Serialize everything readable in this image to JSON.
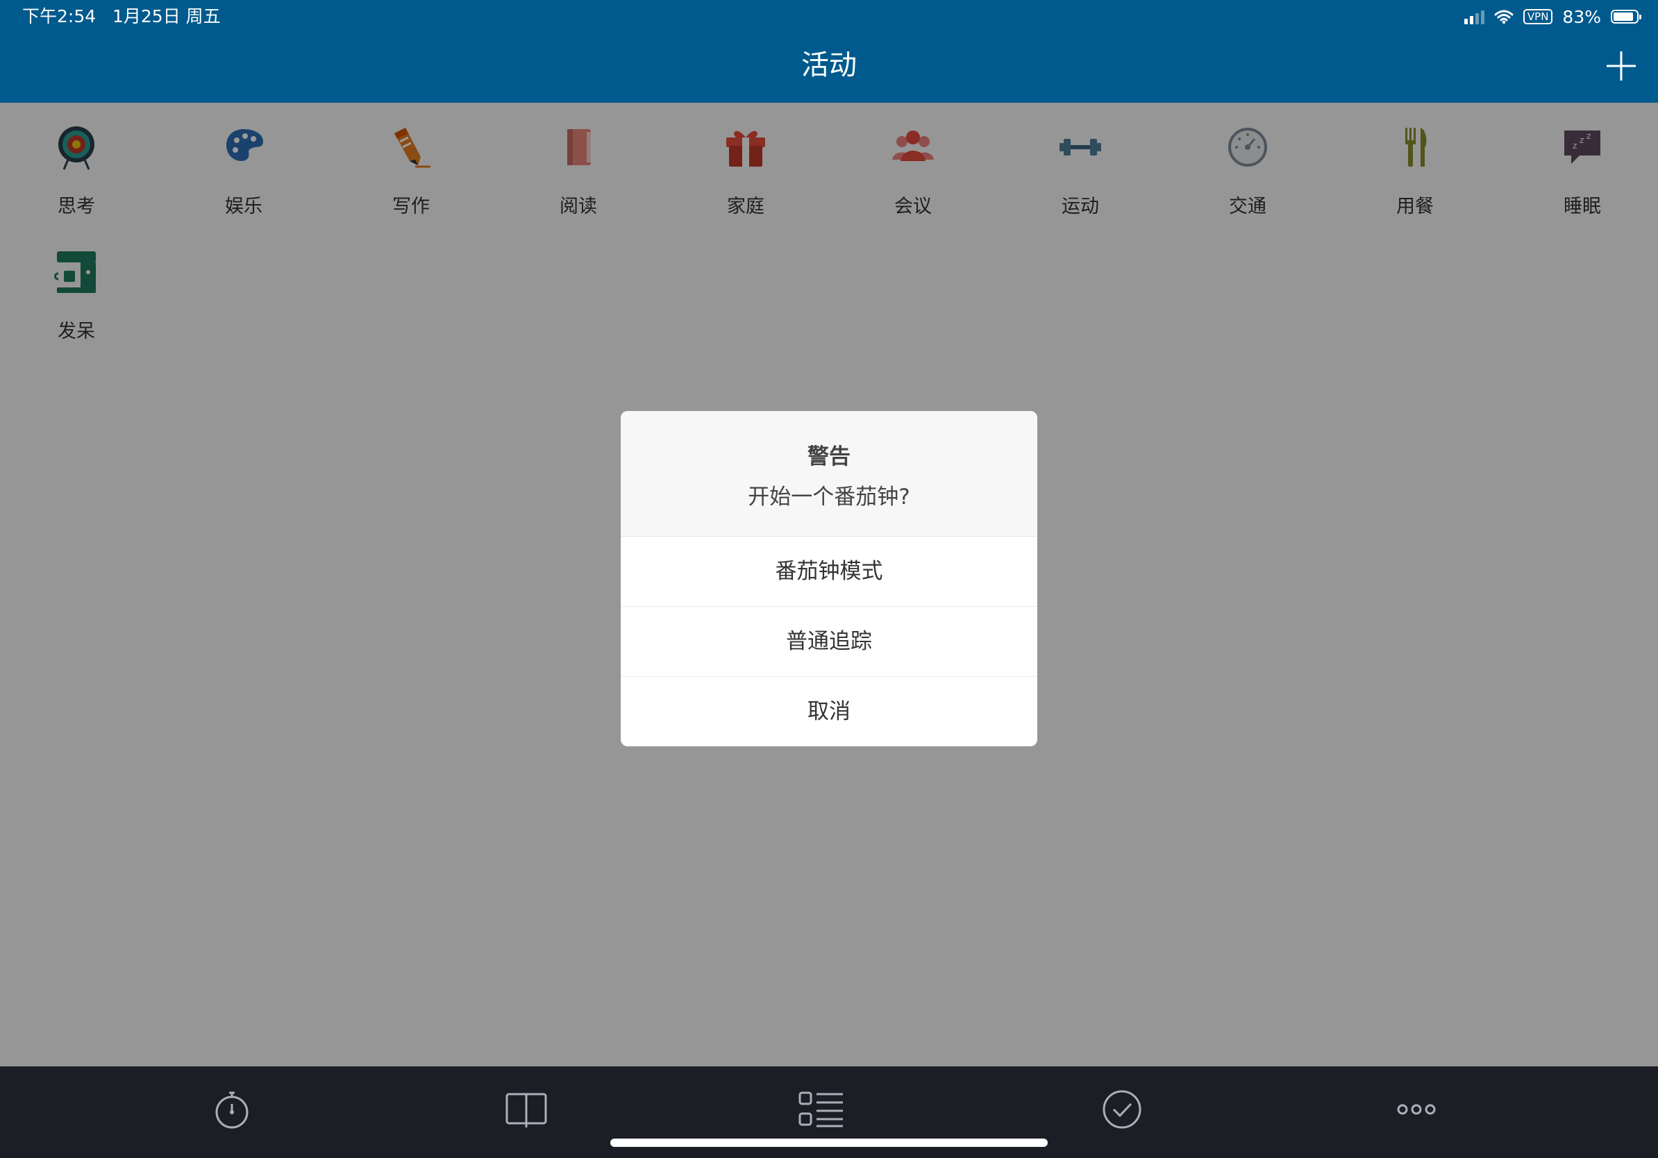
{
  "status_bar": {
    "time": "下午2:54",
    "date": "1月25日 周五",
    "battery": "83%",
    "vpn": "VPN"
  },
  "header": {
    "title": "活动",
    "add_icon": "plus-icon"
  },
  "activities": [
    {
      "label": "思考",
      "icon": "target-icon",
      "color": "#c0392b"
    },
    {
      "label": "娱乐",
      "icon": "palette-icon",
      "color": "#2d6fb4"
    },
    {
      "label": "写作",
      "icon": "pencil-icon",
      "color": "#e67e22"
    },
    {
      "label": "阅读",
      "icon": "book-icon",
      "color": "#e8857a"
    },
    {
      "label": "家庭",
      "icon": "gift-icon",
      "color": "#c0392b"
    },
    {
      "label": "会议",
      "icon": "people-icon",
      "color": "#e74c3c"
    },
    {
      "label": "运动",
      "icon": "dumbbell-icon",
      "color": "#4f7f9b"
    },
    {
      "label": "交通",
      "icon": "speedometer-icon",
      "color": "#7f8c9a"
    },
    {
      "label": "用餐",
      "icon": "fork-knife-icon",
      "color": "#8a8c2e"
    },
    {
      "label": "睡眠",
      "icon": "sleep-bubble-icon",
      "color": "#5e4a60"
    },
    {
      "label": "发呆",
      "icon": "coffee-machine-icon",
      "color": "#1e7a5e"
    }
  ],
  "dialog": {
    "title": "警告",
    "message": "开始一个番茄钟?",
    "buttons": [
      "番茄钟模式",
      "普通追踪",
      "取消"
    ]
  },
  "tabbar": {
    "items": [
      "stopwatch-icon",
      "book-open-icon",
      "list-icon",
      "check-circle-icon",
      "more-icon"
    ]
  },
  "colors": {
    "header_bg": "#005a8d",
    "tabbar_bg": "#1c1e26",
    "overlay": "rgba(0,0,0,0.40)"
  }
}
